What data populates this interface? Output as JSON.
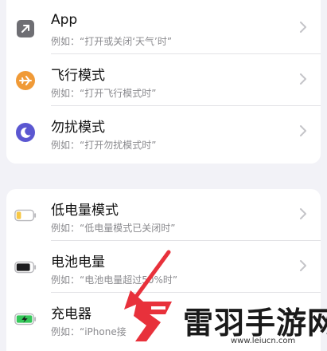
{
  "group1": {
    "rows": [
      {
        "title": "App",
        "subtitle": "例如：“打开或关闭‘天气’时”",
        "icon": "app-shortcut-arrow-icon",
        "icon_color": "#6e6e73"
      },
      {
        "title": "飞行模式",
        "subtitle": "例如：“打开飞行模式时”",
        "icon": "airplane-icon",
        "icon_color": "#f09a37"
      },
      {
        "title": "勿扰模式",
        "subtitle": "例如：“打开勿扰模式时”",
        "icon": "moon-icon",
        "icon_color": "#5b57d1"
      }
    ]
  },
  "group2": {
    "rows": [
      {
        "title": "低电量模式",
        "subtitle": "例如：“低电量模式已关闭时”",
        "icon": "battery-low-icon",
        "icon_color": "#f7c744"
      },
      {
        "title": "电池电量",
        "subtitle": "例如：“电池电量超过50%时”",
        "icon": "battery-level-icon",
        "icon_color": "#1c1c1e"
      },
      {
        "title": "充电器",
        "subtitle": "例如：“iPhone接",
        "icon": "battery-charging-icon",
        "icon_color": "#34c759"
      }
    ]
  },
  "watermark": {
    "brand": "雷羽手游网",
    "url": "www.leiucn.com",
    "accent": "#e8313b"
  }
}
